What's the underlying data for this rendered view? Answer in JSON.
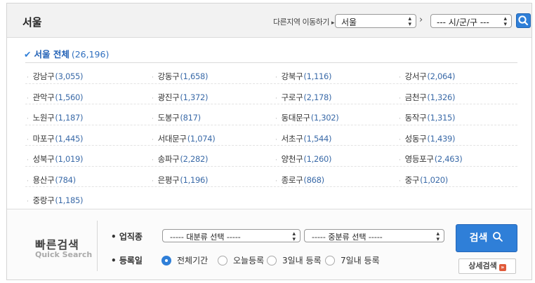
{
  "header": {
    "region": "서울",
    "move_label": "다른지역 이동하기",
    "move_arrow": "▸",
    "city_select": "서울",
    "district_select": "--- 시/군/구 ---",
    "chevron": "›"
  },
  "all": {
    "label": "서울 전체",
    "count": "(26,196)"
  },
  "districts": [
    {
      "name": "강남구",
      "count": "(3,055)"
    },
    {
      "name": "강동구",
      "count": "(1,658)"
    },
    {
      "name": "강북구",
      "count": "(1,116)"
    },
    {
      "name": "강서구",
      "count": "(2,064)"
    },
    {
      "name": "관악구",
      "count": "(1,560)"
    },
    {
      "name": "광진구",
      "count": "(1,372)"
    },
    {
      "name": "구로구",
      "count": "(2,178)"
    },
    {
      "name": "금천구",
      "count": "(1,326)"
    },
    {
      "name": "노원구",
      "count": "(1,187)"
    },
    {
      "name": "도봉구",
      "count": "(817)"
    },
    {
      "name": "동대문구",
      "count": "(1,302)"
    },
    {
      "name": "동작구",
      "count": "(1,315)"
    },
    {
      "name": "마포구",
      "count": "(1,445)"
    },
    {
      "name": "서대문구",
      "count": "(1,074)"
    },
    {
      "name": "서초구",
      "count": "(1,544)"
    },
    {
      "name": "성동구",
      "count": "(1,439)"
    },
    {
      "name": "성북구",
      "count": "(1,019)"
    },
    {
      "name": "송파구",
      "count": "(2,282)"
    },
    {
      "name": "양천구",
      "count": "(1,260)"
    },
    {
      "name": "영등포구",
      "count": "(2,463)"
    },
    {
      "name": "용산구",
      "count": "(784)"
    },
    {
      "name": "은평구",
      "count": "(1,196)"
    },
    {
      "name": "종로구",
      "count": "(868)"
    },
    {
      "name": "중구",
      "count": "(1,020)"
    },
    {
      "name": "중랑구",
      "count": "(1,185)"
    }
  ],
  "quick": {
    "title": "빠른검색",
    "subtitle": "Quick Search",
    "job_label": "• 업직종",
    "date_label": "• 등록일",
    "major_select": "----- 대분류 선택 -----",
    "minor_select": "----- 중분류 선택 -----",
    "radios": [
      "전체기간",
      "오늘등록",
      "3일내 등록",
      "7일내 등록"
    ],
    "selected_radio": 0,
    "search_button": "검색",
    "detail_button": "상세검색",
    "detail_badge": "»"
  },
  "colors": {
    "accent": "#2f7fd8",
    "count": "#3a6aa8"
  }
}
